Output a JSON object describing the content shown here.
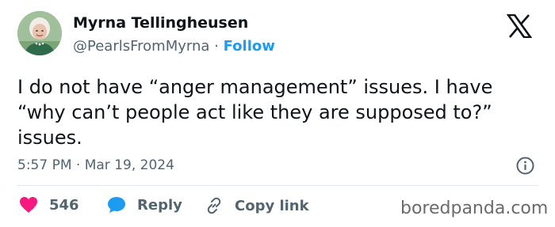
{
  "author": {
    "name": "Myrna Tellingheusen",
    "handle": "@PearlsFromMyrna",
    "separator": "·",
    "follow_label": "Follow"
  },
  "tweet": {
    "text": "I do not have “anger management” issues.  I have “why can’t people act like they are supposed to?” issues.",
    "timestamp": "5:57 PM · Mar 19, 2024"
  },
  "actions": {
    "likes": "546",
    "reply_label": "Reply",
    "copy_link_label": "Copy link"
  },
  "watermark": "boredpanda.com",
  "colors": {
    "heart": "#f91880",
    "reply_bubble": "#1d9bf0",
    "follow": "#1d9bf0"
  }
}
